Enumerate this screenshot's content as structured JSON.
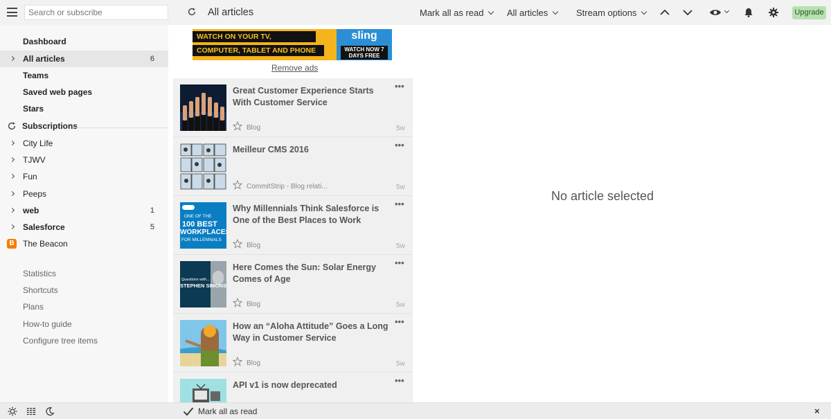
{
  "topbar": {
    "search_placeholder": "Search or subscribe",
    "title": "All articles",
    "mark_all_read": "Mark all as read",
    "filter": "All articles",
    "stream_options": "Stream options",
    "upgrade": "Upgrade"
  },
  "sidebar": {
    "main": [
      {
        "label": "Dashboard",
        "count": ""
      },
      {
        "label": "All articles",
        "count": "6"
      },
      {
        "label": "Teams",
        "count": ""
      },
      {
        "label": "Saved web pages",
        "count": ""
      },
      {
        "label": "Stars",
        "count": ""
      }
    ],
    "subscriptions_label": "Subscriptions",
    "feeds": [
      {
        "label": "City Life",
        "count": ""
      },
      {
        "label": "TJWV",
        "count": ""
      },
      {
        "label": "Fun",
        "count": ""
      },
      {
        "label": "Peeps",
        "count": ""
      },
      {
        "label": "web",
        "count": "1"
      },
      {
        "label": "Salesforce",
        "count": "5"
      },
      {
        "label": "The Beacon",
        "count": ""
      }
    ],
    "footer_links": [
      "Statistics",
      "Shortcuts",
      "Plans",
      "How-to guide",
      "Configure tree items"
    ]
  },
  "ad": {
    "line1": "WATCH ON YOUR TV,",
    "line2": "COMPUTER, TABLET AND PHONE",
    "brand": "sling",
    "cta": "WATCH NOW 7 DAYS FREE",
    "remove": "Remove ads"
  },
  "articles": [
    {
      "title": "Great Customer Experience Starts With Customer Service",
      "source": "Blog",
      "age": "5w",
      "more": "•••"
    },
    {
      "title": "Meilleur CMS 2016",
      "source": "CommitStrip - Blog relati...",
      "age": "5w",
      "more": "•••"
    },
    {
      "title": "Why Millennials Think Salesforce is One of the Best Places to Work",
      "source": "Blog",
      "age": "5w",
      "more": "•••"
    },
    {
      "title": "Here Comes the Sun: Solar Energy Comes of Age",
      "source": "Blog",
      "age": "5w",
      "more": "•••"
    },
    {
      "title": "How an “Aloha Attitude” Goes a Long Way in Customer Service",
      "source": "Blog",
      "age": "5w",
      "more": "•••"
    },
    {
      "title": "API v1 is now deprecated",
      "source": "",
      "age": "",
      "more": "•••"
    }
  ],
  "thumb_texts": {
    "best_line1": "ONE OF THE",
    "best_line2": "100 BEST",
    "best_line3": "WORKPLACES",
    "best_line4": "FOR MILLENNIALS",
    "solar_line1": "Questions with...",
    "solar_line2": "STEPHEN SIMONS"
  },
  "reader": {
    "empty": "No article selected"
  },
  "bottombar": {
    "mark_all_read": "Mark all as read",
    "close": "×"
  },
  "colors": {
    "upgrade_bg": "#b8e0b1",
    "ad_bg": "#f5b31c",
    "sling_blue": "#2a8fd6",
    "blogger_orange": "#f57d00"
  }
}
